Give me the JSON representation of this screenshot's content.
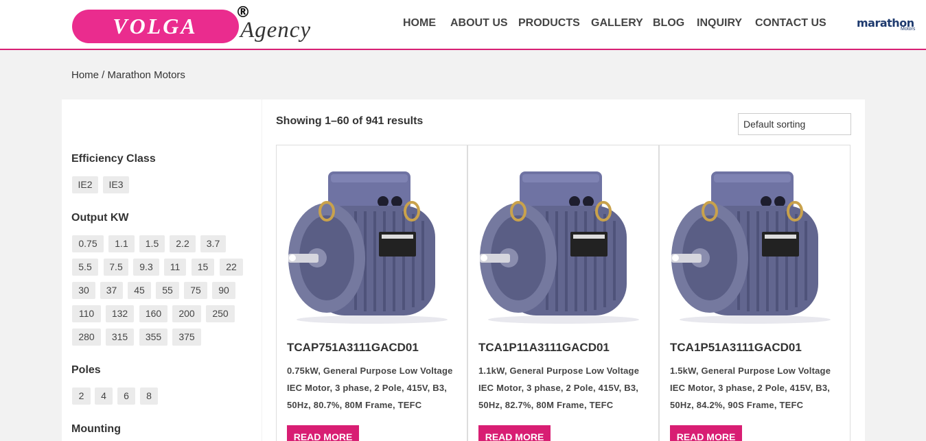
{
  "header": {
    "logo_text": "VOLGA",
    "logo_reg": "®",
    "logo_suffix": "Agency",
    "nav": [
      {
        "label": "HOME"
      },
      {
        "label": "ABOUT US"
      },
      {
        "label": "PRODUCTS"
      },
      {
        "label": "GALLERY"
      },
      {
        "label": "BLOG"
      },
      {
        "label": "INQUIRY"
      },
      {
        "label": "CONTACT US"
      }
    ],
    "brand_name": "marathon",
    "brand_sub": "Motors"
  },
  "breadcrumb": {
    "home": "Home",
    "separator": " / ",
    "current": "Marathon Motors"
  },
  "filters": {
    "efficiency": {
      "title": "Efficiency Class",
      "options": [
        "IE2",
        "IE3"
      ]
    },
    "output": {
      "title": "Output KW",
      "options": [
        "0.75",
        "1.1",
        "1.5",
        "2.2",
        "3.7",
        "5.5",
        "7.5",
        "9.3",
        "11",
        "15",
        "22",
        "30",
        "37",
        "45",
        "55",
        "75",
        "90",
        "110",
        "132",
        "160",
        "200",
        "250",
        "280",
        "315",
        "355",
        "375"
      ]
    },
    "poles": {
      "title": "Poles",
      "options": [
        "2",
        "4",
        "6",
        "8"
      ]
    },
    "mounting": {
      "title": "Mounting"
    }
  },
  "results": {
    "count_text": "Showing 1–60 of 941 results",
    "sort_selected": "Default sorting"
  },
  "products": [
    {
      "title": "TCAP751A3111GACD01",
      "description": "0.75kW, General Purpose Low Voltage IEC Motor, 3 phase, 2 Pole, 415V, B3, 50Hz, 80.7%, 80M Frame, TEFC",
      "button": "READ MORE"
    },
    {
      "title": "TCA1P11A3111GACD01",
      "description": "1.1kW, General Purpose Low Voltage IEC Motor, 3 phase, 2 Pole, 415V, B3, 50Hz, 82.7%, 80M Frame, TEFC",
      "button": "READ MORE"
    },
    {
      "title": "TCA1P51A3111GACD01",
      "description": "1.5kW, General Purpose Low Voltage IEC Motor, 3 phase, 2 Pole, 415V, B3, 50Hz, 84.2%, 90S Frame, TEFC",
      "button": "READ MORE"
    }
  ],
  "colors": {
    "accent": "#d81e73",
    "logo_pink": "#ea2c8e",
    "motor": "#6d71a0"
  }
}
